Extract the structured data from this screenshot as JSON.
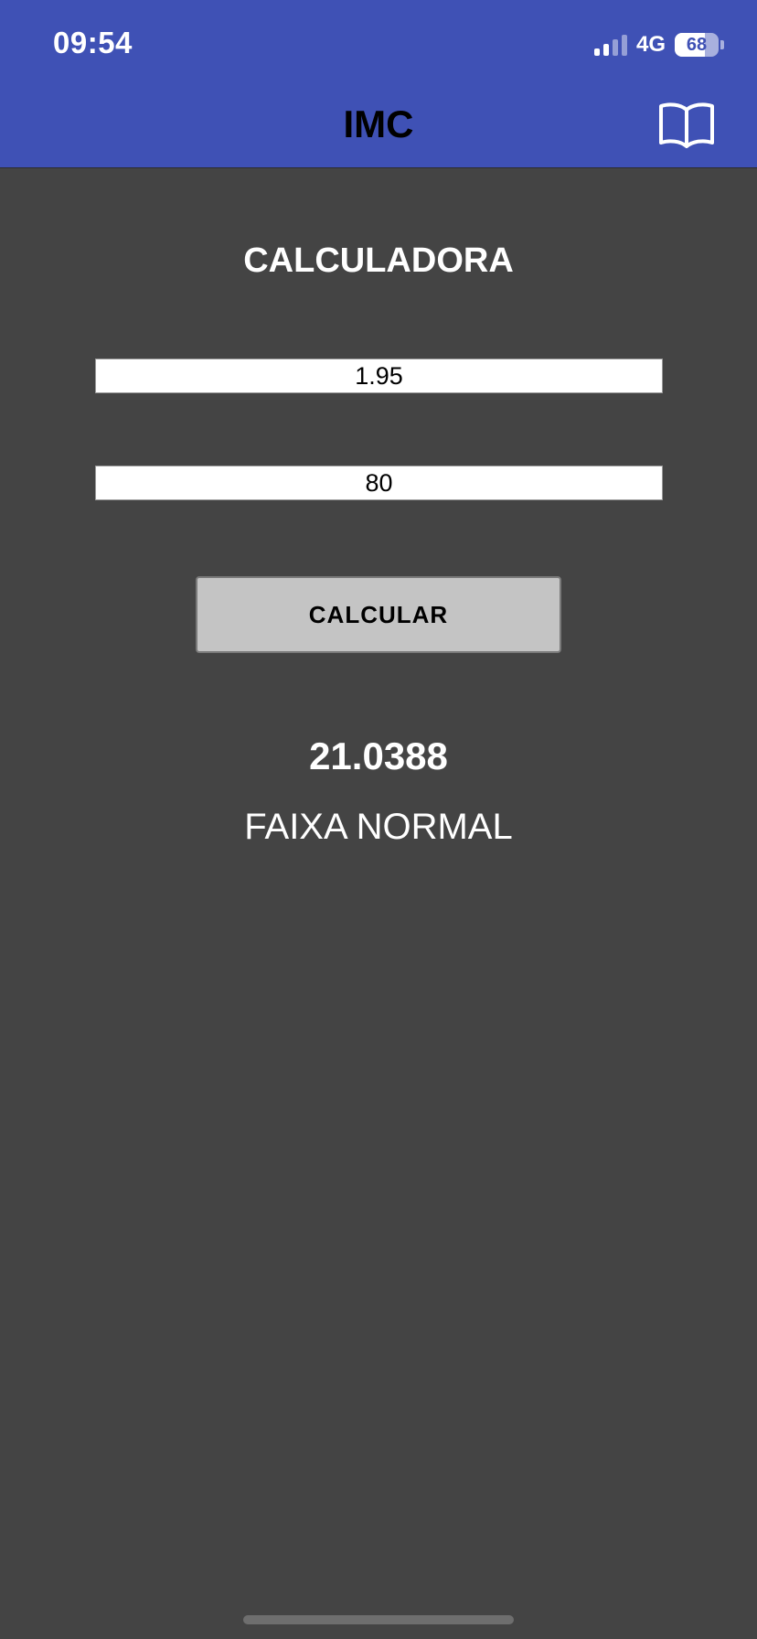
{
  "status_bar": {
    "time": "09:54",
    "network": "4G",
    "battery_level": "68"
  },
  "app_bar": {
    "title": "IMC",
    "book_icon": "book-open-icon"
  },
  "calculator": {
    "title": "CALCULADORA",
    "height_value": "1.95",
    "weight_value": "80",
    "calculate_label": "CALCULAR"
  },
  "result": {
    "value": "21.0388",
    "category": "FAIXA NORMAL"
  },
  "colors": {
    "header": "#3f51b5",
    "background": "#444444",
    "button": "#c4c4c4"
  }
}
